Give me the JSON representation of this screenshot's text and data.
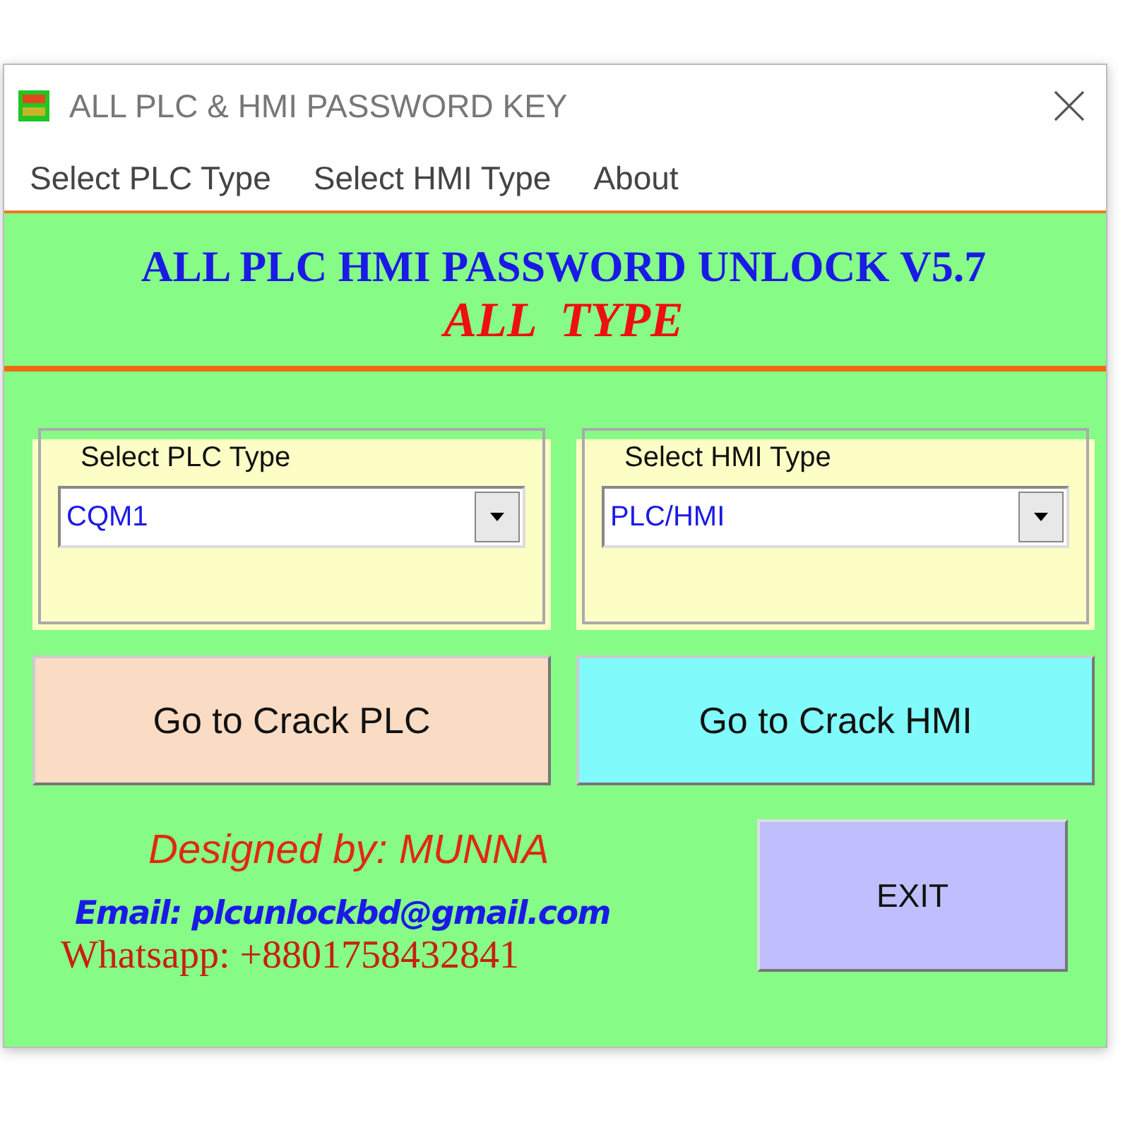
{
  "window": {
    "title": "ALL PLC & HMI PASSWORD KEY"
  },
  "menu": [
    "Select PLC Type",
    "Select HMI Type",
    "About"
  ],
  "heading": {
    "title": "ALL PLC HMI PASSWORD UNLOCK V5.7",
    "subtitle": "ALL  TYPE"
  },
  "groups": [
    {
      "label": "Select PLC Type",
      "value": "CQM1"
    },
    {
      "label": "Select HMI Type",
      "value": "PLC/HMI"
    }
  ],
  "buttons": [
    {
      "label": "Go to Crack PLC",
      "color": "#fadcc4"
    },
    {
      "label": "Go to Crack HMI",
      "color": "#80fafa"
    }
  ],
  "credits": {
    "designer": "Designed by: MUNNA",
    "email": "Email: plcunlockbd@gmail.com",
    "whatsapp": "Whatsapp: +8801758432841"
  },
  "exit_button": "EXIT"
}
